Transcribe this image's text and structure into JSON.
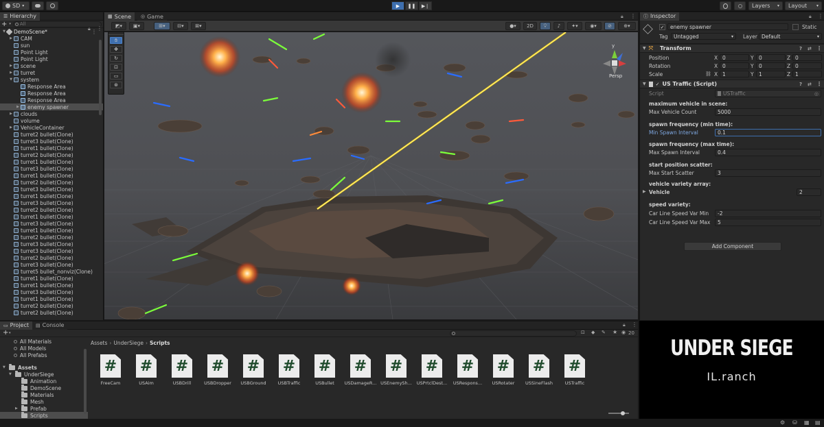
{
  "topbar": {
    "account": "SD",
    "layers": "Layers",
    "layout": "Layout"
  },
  "hierarchy": {
    "tab": "Hierarchy",
    "search_placeholder": "All",
    "scene": "DemoScene*",
    "items": [
      {
        "label": "CAM",
        "depth": 1,
        "arrow": "▶",
        "sel": false
      },
      {
        "label": "sun",
        "depth": 1,
        "arrow": "",
        "sel": false
      },
      {
        "label": "Point Light",
        "depth": 1,
        "arrow": "",
        "sel": false
      },
      {
        "label": "Point Light",
        "depth": 1,
        "arrow": "",
        "sel": false
      },
      {
        "label": "scene",
        "depth": 1,
        "arrow": "▶",
        "sel": false
      },
      {
        "label": "turret",
        "depth": 1,
        "arrow": "▶",
        "sel": false
      },
      {
        "label": "system",
        "depth": 1,
        "arrow": "▼",
        "sel": false
      },
      {
        "label": "Response Area",
        "depth": 2,
        "arrow": "",
        "sel": false
      },
      {
        "label": "Response Area",
        "depth": 2,
        "arrow": "",
        "sel": false
      },
      {
        "label": "Response Area",
        "depth": 2,
        "arrow": "",
        "sel": false
      },
      {
        "label": "enemy spawner",
        "depth": 2,
        "arrow": "▶",
        "sel": true
      },
      {
        "label": "clouds",
        "depth": 1,
        "arrow": "▶",
        "sel": false
      },
      {
        "label": "volume",
        "depth": 1,
        "arrow": "",
        "sel": false
      },
      {
        "label": "VehicleContainer",
        "depth": 1,
        "arrow": "▶",
        "sel": false
      },
      {
        "label": "turret2 bullet(Clone)",
        "depth": 1,
        "arrow": "",
        "sel": false
      },
      {
        "label": "turret3 bullet(Clone)",
        "depth": 1,
        "arrow": "",
        "sel": false
      },
      {
        "label": "turret1 bullet(Clone)",
        "depth": 1,
        "arrow": "",
        "sel": false
      },
      {
        "label": "turret2 bullet(Clone)",
        "depth": 1,
        "arrow": "",
        "sel": false
      },
      {
        "label": "turret1 bullet(Clone)",
        "depth": 1,
        "arrow": "",
        "sel": false
      },
      {
        "label": "turret3 bullet(Clone)",
        "depth": 1,
        "arrow": "",
        "sel": false
      },
      {
        "label": "turret1 bullet(Clone)",
        "depth": 1,
        "arrow": "",
        "sel": false
      },
      {
        "label": "turret2 bullet(Clone)",
        "depth": 1,
        "arrow": "",
        "sel": false
      },
      {
        "label": "turret3 bullet(Clone)",
        "depth": 1,
        "arrow": "",
        "sel": false
      },
      {
        "label": "turret1 bullet(Clone)",
        "depth": 1,
        "arrow": "",
        "sel": false
      },
      {
        "label": "turret3 bullet(Clone)",
        "depth": 1,
        "arrow": "",
        "sel": false
      },
      {
        "label": "turret2 bullet(Clone)",
        "depth": 1,
        "arrow": "",
        "sel": false
      },
      {
        "label": "turret1 bullet(Clone)",
        "depth": 1,
        "arrow": "",
        "sel": false
      },
      {
        "label": "turret3 bullet(Clone)",
        "depth": 1,
        "arrow": "",
        "sel": false
      },
      {
        "label": "turret1 bullet(Clone)",
        "depth": 1,
        "arrow": "",
        "sel": false
      },
      {
        "label": "turret2 bullet(Clone)",
        "depth": 1,
        "arrow": "",
        "sel": false
      },
      {
        "label": "turret3 bullet(Clone)",
        "depth": 1,
        "arrow": "",
        "sel": false
      },
      {
        "label": "turret3 bullet(Clone)",
        "depth": 1,
        "arrow": "",
        "sel": false
      },
      {
        "label": "turret2 bullet(Clone)",
        "depth": 1,
        "arrow": "",
        "sel": false
      },
      {
        "label": "turret3 bullet(Clone)",
        "depth": 1,
        "arrow": "",
        "sel": false
      },
      {
        "label": "turret5 bullet_nonviz(Clone)",
        "depth": 1,
        "arrow": "",
        "sel": false
      },
      {
        "label": "turret1 bullet(Clone)",
        "depth": 1,
        "arrow": "",
        "sel": false
      },
      {
        "label": "turret1 bullet(Clone)",
        "depth": 1,
        "arrow": "",
        "sel": false
      },
      {
        "label": "turret3 bullet(Clone)",
        "depth": 1,
        "arrow": "",
        "sel": false
      },
      {
        "label": "turret1 bullet(Clone)",
        "depth": 1,
        "arrow": "",
        "sel": false
      },
      {
        "label": "turret2 bullet(Clone)",
        "depth": 1,
        "arrow": "",
        "sel": false
      },
      {
        "label": "turret2 bullet(Clone)",
        "depth": 1,
        "arrow": "",
        "sel": false
      }
    ]
  },
  "scene_view": {
    "tabs": [
      "Scene",
      "Game"
    ],
    "btn_2d": "2D",
    "persp_label": "Persp",
    "gizmo_y": "y"
  },
  "inspector": {
    "tab": "Inspector",
    "object_name": "enemy spawner",
    "static_label": "Static",
    "tag_label": "Tag",
    "tag_value": "Untagged",
    "layer_label": "Layer",
    "layer_value": "Default",
    "transform": {
      "title": "Transform",
      "rows": [
        {
          "label": "Position",
          "x": "0",
          "y": "0",
          "z": "0"
        },
        {
          "label": "Rotation",
          "x": "0",
          "y": "0",
          "z": "0"
        },
        {
          "label": "Scale",
          "x": "1",
          "y": "1",
          "z": "1"
        }
      ],
      "axis_x": "X",
      "axis_y": "Y",
      "axis_z": "Z"
    },
    "script": {
      "title": "US Traffic (Script)",
      "script_label": "Script",
      "script_value": "USTraffic",
      "fields": [
        {
          "header": "maximum vehicle in scene:",
          "label": "Max Vehicle Count",
          "value": "5000",
          "active": false
        },
        {
          "header": "spawn frequency (min time):",
          "label": "Min Spawn Interval",
          "value": "0.1",
          "active": true
        },
        {
          "header": "spawn frequency (max time):",
          "label": "Max Spawn Interval",
          "value": "0.4",
          "active": false
        },
        {
          "header": "start position scatter:",
          "label": "Max Start Scatter",
          "value": "3",
          "active": false
        }
      ],
      "array_header": "vehicle variety array:",
      "array_label": "Vehicle",
      "array_value": "2",
      "speed_header": "speed variety:",
      "speed_fields": [
        {
          "label": "Car Line Speed Var Min",
          "value": "-2"
        },
        {
          "label": "Car Line Speed Var Max",
          "value": "5"
        }
      ]
    },
    "add_component": "Add Component"
  },
  "watermark": {
    "title": "UNDER SIEGE",
    "subtitle": "IL.ranch"
  },
  "project": {
    "tabs": [
      "Project",
      "Console"
    ],
    "favorites": [
      "All Materials",
      "All Models",
      "All Prefabs"
    ],
    "folders": [
      {
        "label": "Assets",
        "depth": 0,
        "arrow": "▼"
      },
      {
        "label": "UnderSiege",
        "depth": 1,
        "arrow": "▼"
      },
      {
        "label": "Animation",
        "depth": 2,
        "arrow": ""
      },
      {
        "label": "DemoScene",
        "depth": 2,
        "arrow": ""
      },
      {
        "label": "Materials",
        "depth": 2,
        "arrow": ""
      },
      {
        "label": "Mesh",
        "depth": 2,
        "arrow": ""
      },
      {
        "label": "Prefab",
        "depth": 2,
        "arrow": "▶"
      },
      {
        "label": "Scripts",
        "depth": 2,
        "arrow": ""
      }
    ],
    "breadcrumb": [
      "Assets",
      "UnderSiege",
      "Scripts"
    ],
    "visible_count": "20",
    "assets": [
      "FreeCam",
      "USAim",
      "USBDrill",
      "USBDropper",
      "USBGround",
      "USBTraffic",
      "USBullet",
      "USDamageR...",
      "USEnemySh...",
      "USPrtclDest...",
      "USRespons...",
      "USRotater",
      "USSineFlash",
      "USTraffic"
    ]
  },
  "colors": {
    "accent": "#3e6fae",
    "panel": "#282828",
    "yellow_beam": "#f2d21c"
  }
}
